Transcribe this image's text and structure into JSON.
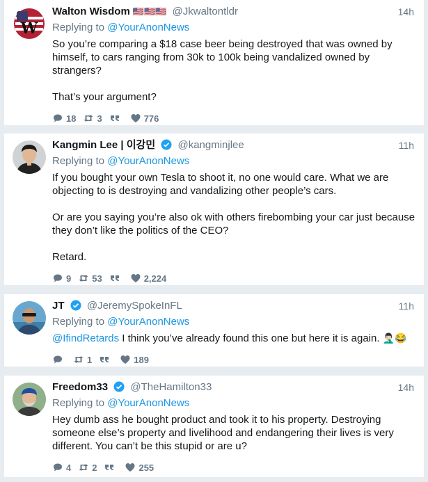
{
  "tweets": [
    {
      "name": "Walton Wisdom",
      "flags": "🇺🇸🇺🇸🇺🇸",
      "handle": "@Jkwaltontldr",
      "time": "14h",
      "reply_prefix": "Replying to ",
      "reply_to": "@YourAnonNews",
      "paragraphs": [
        "So you’re comparing a $18 case beer being destroyed that was owned by himself, to cars ranging from 30k to 100k being vandalized owned by strangers?",
        "That’s your argument?"
      ],
      "replies": "18",
      "retweets": "3",
      "likes": "776"
    },
    {
      "name": "Kangmin Lee | 이강민",
      "handle": "@kangminjlee",
      "time": "11h",
      "reply_prefix": "Replying to ",
      "reply_to": "@YourAnonNews",
      "paragraphs": [
        "If you bought your own Tesla to shoot it, no one would care. What we are objecting to is destroying and vandalizing other people’s cars.",
        "Or are you saying you’re also ok with others firebombing your car just because they don’t like the politics of the CEO?",
        "Retard."
      ],
      "replies": "9",
      "retweets": "53",
      "likes": "2,224"
    },
    {
      "name": "JT",
      "handle": "@JeremySpokeInFL",
      "time": "11h",
      "reply_prefix": "Replying to ",
      "reply_to": "@YourAnonNews",
      "mention": "@IfindRetards",
      "text": " I think you’ve already found this one but here it is again. ",
      "emoji": "🤦🏻‍♂️😂",
      "replies": "",
      "retweets": "1",
      "likes": "189"
    },
    {
      "name": "Freedom33",
      "handle": "@TheHamilton33",
      "time": "14h",
      "reply_prefix": "Replying to ",
      "reply_to": "@YourAnonNews",
      "paragraphs": [
        "Hey dumb ass he bought product and took it to his property. Destroying someone else’s property and livelihood and endangering their lives is very different. You can’t be this stupid or are u?"
      ],
      "replies": "4",
      "retweets": "2",
      "likes": "255"
    }
  ]
}
